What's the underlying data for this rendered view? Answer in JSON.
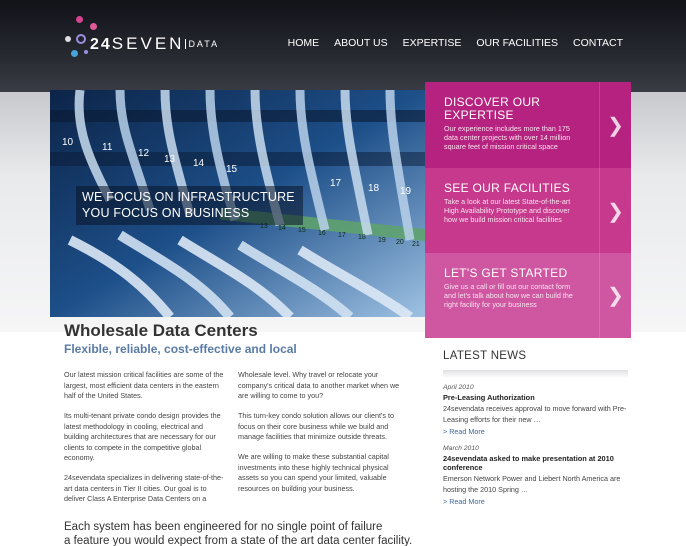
{
  "brand": {
    "logo_prefix": "24",
    "logo_main": "SEVEN",
    "logo_suffix": "DATA"
  },
  "nav": {
    "items": [
      "HOME",
      "ABOUT US",
      "EXPERTISE",
      "OUR FACILITIES",
      "CONTACT"
    ]
  },
  "hero": {
    "caption_line1": "WE FOCUS ON INFRASTRUCTURE",
    "caption_line2": "YOU FOCUS ON BUSINESS",
    "port_numbers": [
      "10",
      "11",
      "12",
      "13",
      "14",
      "15",
      "17",
      "18",
      "19"
    ],
    "panel_numbers": [
      "13",
      "14",
      "15",
      "16",
      "17",
      "18",
      "19",
      "20",
      "21"
    ]
  },
  "promos": [
    {
      "title": "DISCOVER OUR EXPERTISE",
      "text": "Our experience includes more than 175 data center projects with over 14 million square feet of mission critical space",
      "arrow": "❯"
    },
    {
      "title": "SEE OUR FACILITIES",
      "text": "Take a look at our latest State-of-the-art High Availability Prototype and discover how we build mission critical facilities",
      "arrow": "❯"
    },
    {
      "title": "LET'S GET STARTED",
      "text": "Give us a call or fill out our contact form and let's talk about how we can build the right facility for your business",
      "arrow": "❯"
    }
  ],
  "main": {
    "title": "Wholesale Data Centers",
    "subtitle": "Flexible, reliable, cost-effective and local",
    "col1": [
      "Our latest mission critical facilities are some of the largest, most efficient data centers in the eastern half of the United States.",
      "Its multi-tenant private condo design provides the latest methodology in cooling, electrical and building architectures that are necessary for our clients to compete in the competitive global economy.",
      "24sevendata specializes in delivering state-of-the-art data centers in Tier II cities. Our goal is to deliver Class A Enterprise Data Centers on a"
    ],
    "col2": [
      "Wholesale level. Why travel or relocate your company's critical data to another market when we are willing to come to you?",
      "This turn-key condo solution allows our client's to focus on their core business while we build and manage facilities that minimize outside threats.",
      "We are willing to make these substantial capital investments into these highly technical physical assets so you can spend your limited, valuable resources on building your business."
    ],
    "tagline_line1": "Each system has been engineered for no single point of failure",
    "tagline_line2": "a feature you would expect from a state of the art data center facility."
  },
  "news": {
    "title": "LATEST NEWS",
    "items": [
      {
        "date": "April 2010",
        "headline": "Pre-Leasing Authorization",
        "body": "24sevendata receives approval to move forward with Pre-Leasing efforts for their new …",
        "more": "> Read More"
      },
      {
        "date": "March 2010",
        "headline": "24sevendata asked to make presentation at 2010 conference",
        "body": "Emerson Network Power and Liebert North America are hosting the 2010 Spring …",
        "more": "> Read More"
      }
    ]
  },
  "colors": {
    "header_dark": "#1a1b21",
    "promo_1": "#b6227f",
    "promo_2": "#c6398c",
    "promo_3": "#cf57a1",
    "link": "#3b6aa0",
    "subtitle": "#5a7ba6"
  }
}
